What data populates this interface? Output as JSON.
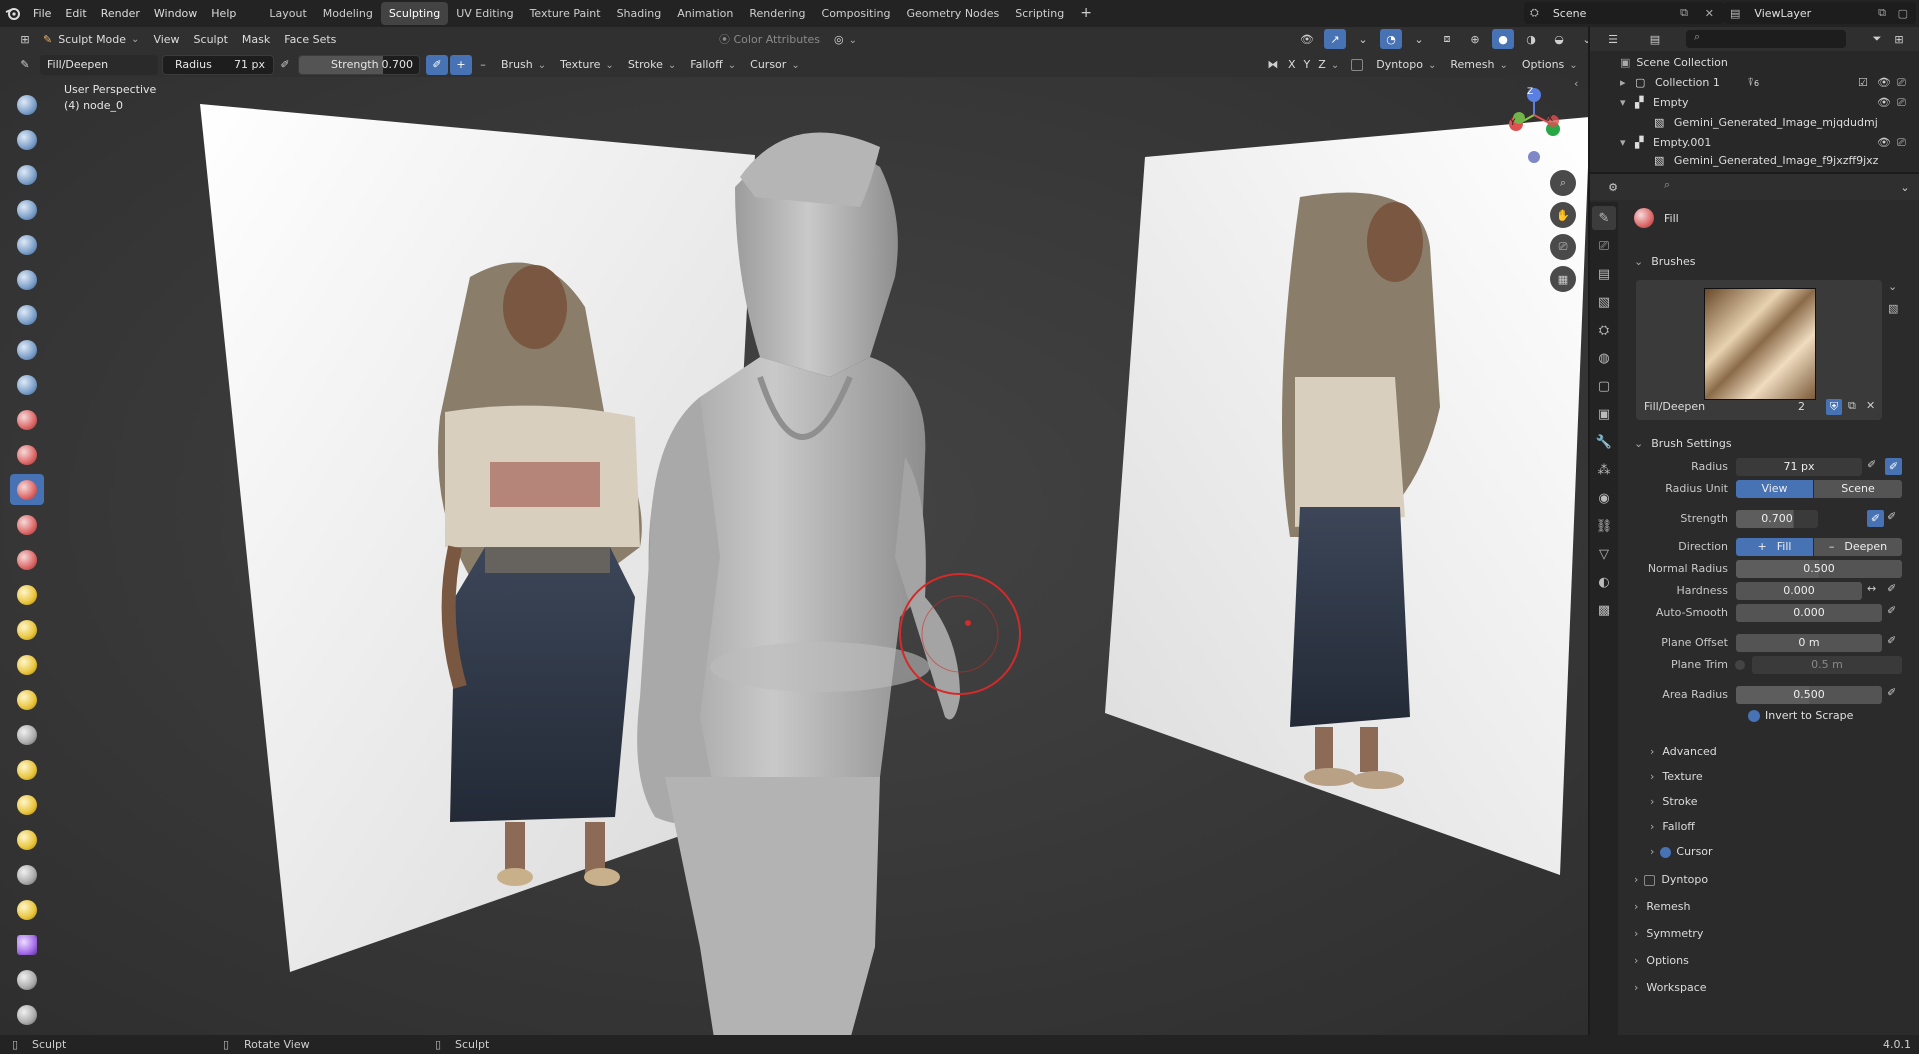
{
  "menu": [
    "File",
    "Edit",
    "Render",
    "Window",
    "Help"
  ],
  "workspaces": [
    {
      "label": "Layout",
      "active": false
    },
    {
      "label": "Modeling",
      "active": false
    },
    {
      "label": "Sculpting",
      "active": true
    },
    {
      "label": "UV Editing",
      "active": false
    },
    {
      "label": "Texture Paint",
      "active": false
    },
    {
      "label": "Shading",
      "active": false
    },
    {
      "label": "Animation",
      "active": false
    },
    {
      "label": "Rendering",
      "active": false
    },
    {
      "label": "Compositing",
      "active": false
    },
    {
      "label": "Geometry Nodes",
      "active": false
    },
    {
      "label": "Scripting",
      "active": false
    }
  ],
  "add_workspace": "+",
  "scene": {
    "name": "Scene",
    "view_layer": "ViewLayer"
  },
  "header1": {
    "mode": "Sculpt Mode",
    "menus": [
      "View",
      "Sculpt",
      "Mask",
      "Face Sets"
    ],
    "color_attributes": "Color Attributes"
  },
  "header2": {
    "brush_name": "Fill/Deepen",
    "radius_label": "Radius",
    "radius_value": "71 px",
    "strength_label": "Strength",
    "strength_value": "0.700",
    "plus": "+",
    "minus": "–",
    "menus": [
      "Brush",
      "Texture",
      "Stroke",
      "Falloff",
      "Cursor"
    ],
    "axes": [
      "X",
      "Y",
      "Z"
    ],
    "right_menus": [
      "Dyntopo",
      "Remesh",
      "Options"
    ]
  },
  "viewport": {
    "title": "User Perspective",
    "subtitle": "(4) node_0"
  },
  "gizmo": {
    "z": "Z",
    "y": "Y",
    "x": "X"
  },
  "outliner": {
    "root": "Scene Collection",
    "items": [
      {
        "label": "Collection 1",
        "indent": 1,
        "badge": "6"
      },
      {
        "label": "Empty",
        "indent": 1
      },
      {
        "label": "Gemini_Generated_Image_mjqdudmj",
        "indent": 2
      },
      {
        "label": "Empty.001",
        "indent": 1
      },
      {
        "label": "Gemini_Generated_Image_f9jxzff9jxz",
        "indent": 2
      }
    ]
  },
  "properties": {
    "brush_tab": "Fill",
    "brushes_header": "Brushes",
    "brush_asset_name": "Fill/Deepen",
    "brush_users": "2",
    "brush_settings_header": "Brush Settings",
    "radius_label": "Radius",
    "radius_value": "71 px",
    "radius_unit_label": "Radius Unit",
    "radius_unit_view": "View",
    "radius_unit_scene": "Scene",
    "strength_label": "Strength",
    "strength_value": "0.700",
    "direction_label": "Direction",
    "dir_fill": "Fill",
    "dir_deepen": "Deepen",
    "normal_radius_label": "Normal Radius",
    "normal_radius_value": "0.500",
    "hardness_label": "Hardness",
    "hardness_value": "0.000",
    "autosmooth_label": "Auto-Smooth",
    "autosmooth_value": "0.000",
    "plane_offset_label": "Plane Offset",
    "plane_offset_value": "0 m",
    "plane_trim_label": "Plane Trim",
    "plane_trim_value": "0.5 m",
    "area_radius_label": "Area Radius",
    "area_radius_value": "0.500",
    "invert_scrape": "Invert to Scrape",
    "subsections": [
      "Advanced",
      "Texture",
      "Stroke",
      "Falloff",
      "Cursor"
    ],
    "sections": [
      "Dyntopo",
      "Remesh",
      "Symmetry",
      "Options",
      "Workspace"
    ]
  },
  "statusbar": {
    "left": "Sculpt",
    "mid": "Rotate View",
    "right": "Sculpt",
    "version": "4.0.1"
  },
  "colors": {
    "accent": "#4772b3",
    "brush_ring": "#d42a2a",
    "panel": "#2b2b2b"
  }
}
